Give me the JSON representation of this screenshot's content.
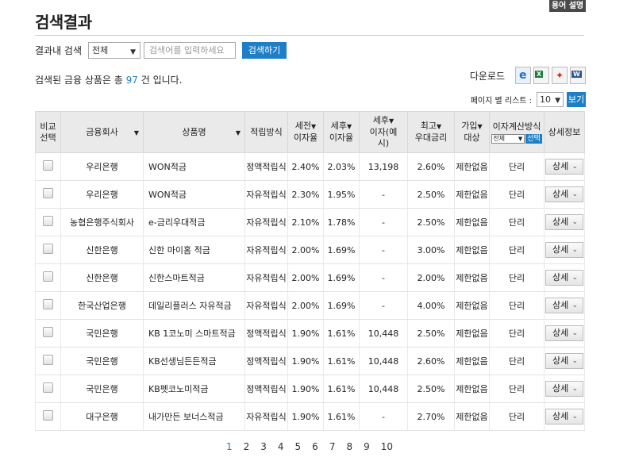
{
  "header": {
    "glossary_label": "용어 설명",
    "title": "검색결과"
  },
  "filter": {
    "label": "결과내 검색",
    "select_value": "전체",
    "input_placeholder": "검색어를 입력하세요",
    "search_label": "검색하기"
  },
  "summary": {
    "prefix": "검색된 금융 상품은 총 ",
    "count": "97",
    "suffix": " 건 입니다."
  },
  "download": {
    "label": "다운로드",
    "icons": [
      "ie-icon",
      "excel-icon",
      "pdf-icon",
      "word-icon"
    ]
  },
  "page_size": {
    "label": "페이지 별 리스트 :",
    "value": "10",
    "view_label": "보기"
  },
  "table": {
    "headers": {
      "compare": [
        "비교",
        "선택"
      ],
      "company": "금융회사",
      "product": "상품명",
      "method": "적립방식",
      "pretax": [
        "세전",
        "이자율"
      ],
      "aftertax": [
        "세후",
        "이자율"
      ],
      "aftertax_interest": [
        "세후",
        "이자(예",
        "시)"
      ],
      "max_rate": [
        "최고",
        "우대금리"
      ],
      "join": [
        "가입",
        "대상"
      ],
      "calc": "이자계산방식",
      "calc_select": "전체",
      "calc_btn": "선택",
      "detail": "상세정보"
    },
    "detail_label": "상세",
    "rows": [
      {
        "company": "우리은행",
        "product": "WON적금",
        "method": "정액적립식",
        "pretax": "2.40%",
        "aftertax": "2.03%",
        "interest": "13,198",
        "max": "2.60%",
        "join": "제한없음",
        "calc": "단리"
      },
      {
        "company": "우리은행",
        "product": "WON적금",
        "method": "자유적립식",
        "pretax": "2.30%",
        "aftertax": "1.95%",
        "interest": "-",
        "max": "2.50%",
        "join": "제한없음",
        "calc": "단리"
      },
      {
        "company": "농협은행주식회사",
        "product": "e-금리우대적금",
        "method": "자유적립식",
        "pretax": "2.10%",
        "aftertax": "1.78%",
        "interest": "-",
        "max": "2.50%",
        "join": "제한없음",
        "calc": "단리"
      },
      {
        "company": "신한은행",
        "product": "신한 마이홈 적금",
        "method": "자유적립식",
        "pretax": "2.00%",
        "aftertax": "1.69%",
        "interest": "-",
        "max": "3.00%",
        "join": "제한없음",
        "calc": "단리"
      },
      {
        "company": "신한은행",
        "product": "신한스마트적금",
        "method": "자유적립식",
        "pretax": "2.00%",
        "aftertax": "1.69%",
        "interest": "-",
        "max": "2.00%",
        "join": "제한없음",
        "calc": "단리"
      },
      {
        "company": "한국산업은행",
        "product": "데일리플러스 자유적금",
        "method": "자유적립식",
        "pretax": "2.00%",
        "aftertax": "1.69%",
        "interest": "-",
        "max": "4.00%",
        "join": "제한없음",
        "calc": "단리"
      },
      {
        "company": "국민은행",
        "product": "KB 1코노미 스마트적금",
        "method": "정액적립식",
        "pretax": "1.90%",
        "aftertax": "1.61%",
        "interest": "10,448",
        "max": "2.50%",
        "join": "제한없음",
        "calc": "단리"
      },
      {
        "company": "국민은행",
        "product": "KB선생님든든적금",
        "method": "정액적립식",
        "pretax": "1.90%",
        "aftertax": "1.61%",
        "interest": "10,448",
        "max": "2.60%",
        "join": "제한없음",
        "calc": "단리"
      },
      {
        "company": "국민은행",
        "product": "KB펫코노미적금",
        "method": "정액적립식",
        "pretax": "1.90%",
        "aftertax": "1.61%",
        "interest": "10,448",
        "max": "2.50%",
        "join": "제한없음",
        "calc": "단리"
      },
      {
        "company": "대구은행",
        "product": "내가만든 보너스적금",
        "method": "자유적립식",
        "pretax": "1.90%",
        "aftertax": "1.61%",
        "interest": "-",
        "max": "2.70%",
        "join": "제한없음",
        "calc": "단리"
      }
    ]
  },
  "pagination": {
    "pages": [
      "1",
      "2",
      "3",
      "4",
      "5",
      "6",
      "7",
      "8",
      "9",
      "10"
    ],
    "active": "1"
  }
}
